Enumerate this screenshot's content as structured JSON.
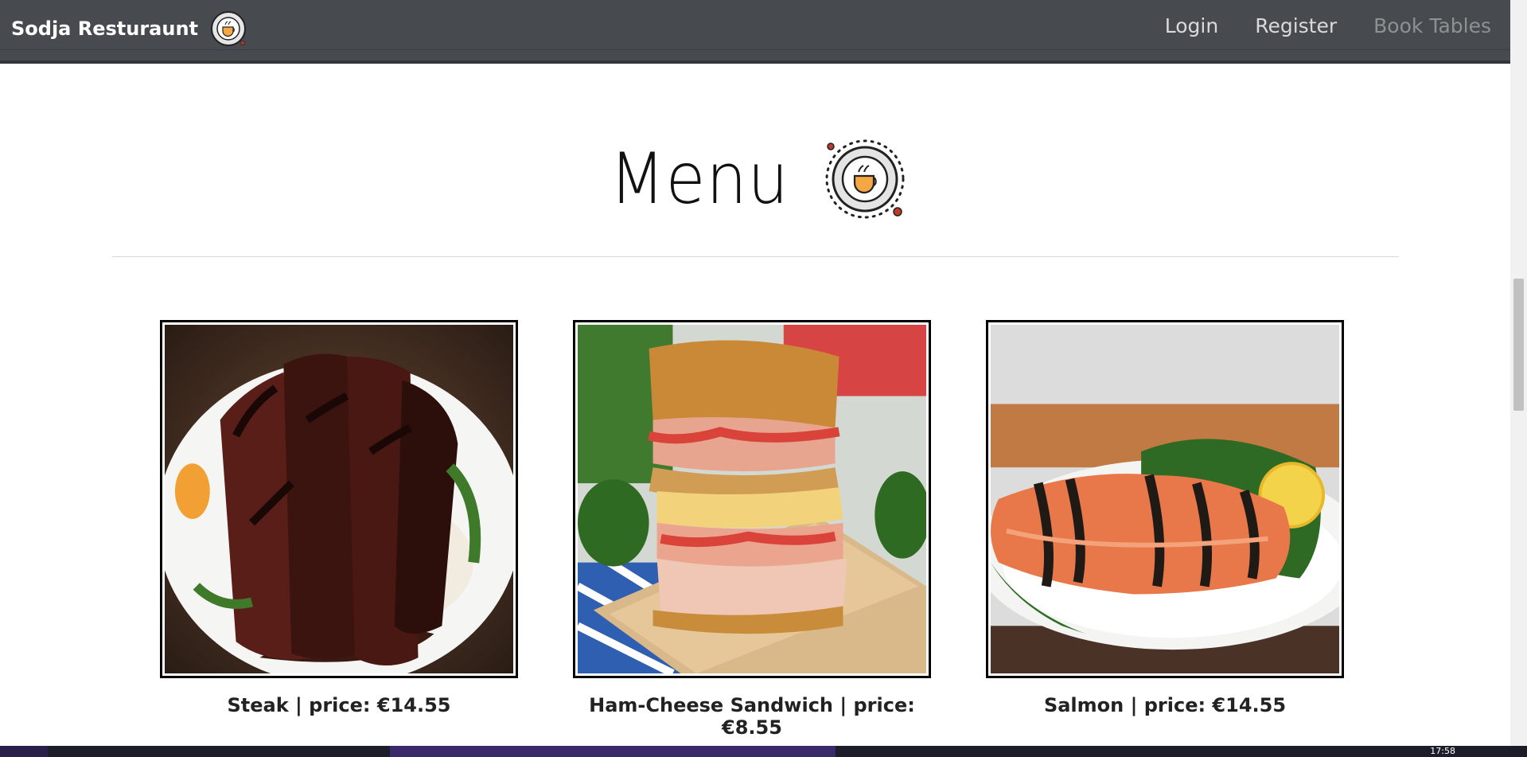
{
  "navbar": {
    "brand": "Sodja Resturaunt",
    "links": [
      {
        "label": "Login"
      },
      {
        "label": "Register"
      },
      {
        "label": "Book Tables"
      }
    ]
  },
  "main": {
    "heading": "Menu",
    "items": [
      {
        "caption": "Steak | price: €14.55"
      },
      {
        "caption": "Ham-Cheese Sandwich | price: €8.55"
      },
      {
        "caption": "Salmon | price: €14.55"
      }
    ]
  },
  "taskbar": {
    "clock": "17:58"
  }
}
